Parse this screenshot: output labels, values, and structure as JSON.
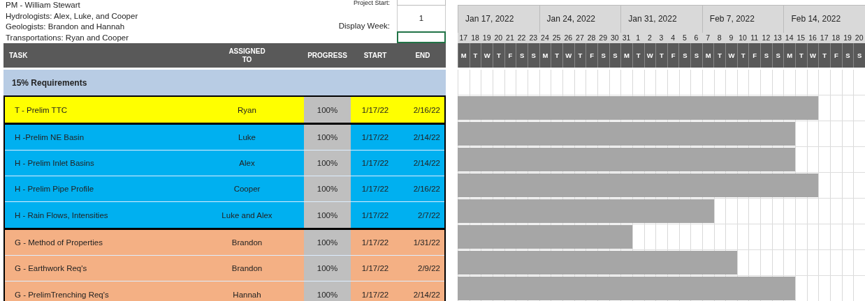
{
  "info": {
    "lines": [
      "PM - William Stewart",
      "Hydrologists: Alex, Luke, and Cooper",
      "Geologists: Brandon and Hannah",
      "Transportations: Ryan and Cooper"
    ],
    "project_start": {
      "label": "Project Start:"
    },
    "display_week": {
      "label": "Display Week:",
      "value": "1"
    },
    "spare_cell": {
      "selected": true
    }
  },
  "table": {
    "columns": [
      "TASK",
      "ASSIGNED TO",
      "PROGRESS",
      "START",
      "END"
    ],
    "section": "15% Requirements",
    "groups": [
      {
        "color": "#ffff00",
        "tasks": [
          {
            "task": "T - Prelim TTC",
            "assigned": "Ryan",
            "progress": "100%",
            "start": "1/17/22",
            "end": "2/16/22"
          }
        ]
      },
      {
        "color": "#00b0f0",
        "tasks": [
          {
            "task": "H -Prelim NE Basin",
            "assigned": "Luke",
            "progress": "100%",
            "start": "1/17/22",
            "end": "2/14/22"
          },
          {
            "task": "H - Prelim Inlet Basins",
            "assigned": "Alex",
            "progress": "100%",
            "start": "1/17/22",
            "end": "2/14/22"
          },
          {
            "task": "H - Prelim Pipe Profile",
            "assigned": "Cooper",
            "progress": "100%",
            "start": "1/17/22",
            "end": "2/16/22"
          },
          {
            "task": "H - Rain Flows, Intensities",
            "assigned": "Luke and Alex",
            "progress": "100%",
            "start": "1/17/22",
            "end": "2/7/22"
          }
        ]
      },
      {
        "color": "#f4b084",
        "tasks": [
          {
            "task": "G - Method of Properties",
            "assigned": "Brandon",
            "progress": "100%",
            "start": "1/17/22",
            "end": "1/31/22"
          },
          {
            "task": "G - Earthwork Req's",
            "assigned": "Brandon",
            "progress": "100%",
            "start": "1/17/22",
            "end": "2/9/22"
          },
          {
            "task": "G - PrelimTrenching Req's",
            "assigned": "Hannah",
            "progress": "100%",
            "start": "1/17/22",
            "end": "2/14/22"
          }
        ]
      }
    ]
  },
  "timeline": {
    "weeks": [
      "Jan 17, 2022",
      "Jan 24, 2022",
      "Jan 31, 2022",
      "Feb 7, 2022",
      "Feb 14, 2022"
    ],
    "days": [
      {
        "date": "17",
        "weekday": "M"
      },
      {
        "date": "18",
        "weekday": "T"
      },
      {
        "date": "19",
        "weekday": "W"
      },
      {
        "date": "20",
        "weekday": "T"
      },
      {
        "date": "21",
        "weekday": "F"
      },
      {
        "date": "22",
        "weekday": "S"
      },
      {
        "date": "23",
        "weekday": "S"
      },
      {
        "date": "24",
        "weekday": "M"
      },
      {
        "date": "25",
        "weekday": "T"
      },
      {
        "date": "26",
        "weekday": "W"
      },
      {
        "date": "27",
        "weekday": "T"
      },
      {
        "date": "28",
        "weekday": "F"
      },
      {
        "date": "29",
        "weekday": "S"
      },
      {
        "date": "30",
        "weekday": "S"
      },
      {
        "date": "31",
        "weekday": "M"
      },
      {
        "date": "1",
        "weekday": "T"
      },
      {
        "date": "2",
        "weekday": "W"
      },
      {
        "date": "3",
        "weekday": "T"
      },
      {
        "date": "4",
        "weekday": "F"
      },
      {
        "date": "5",
        "weekday": "S"
      },
      {
        "date": "6",
        "weekday": "S"
      },
      {
        "date": "7",
        "weekday": "M"
      },
      {
        "date": "8",
        "weekday": "T"
      },
      {
        "date": "9",
        "weekday": "W"
      },
      {
        "date": "10",
        "weekday": "T"
      },
      {
        "date": "11",
        "weekday": "F"
      },
      {
        "date": "12",
        "weekday": "S"
      },
      {
        "date": "13",
        "weekday": "S"
      },
      {
        "date": "14",
        "weekday": "M"
      },
      {
        "date": "15",
        "weekday": "T"
      },
      {
        "date": "16",
        "weekday": "W"
      },
      {
        "date": "17",
        "weekday": "T"
      },
      {
        "date": "18",
        "weekday": "F"
      },
      {
        "date": "19",
        "weekday": "S"
      },
      {
        "date": "20",
        "weekday": "S"
      }
    ]
  }
}
